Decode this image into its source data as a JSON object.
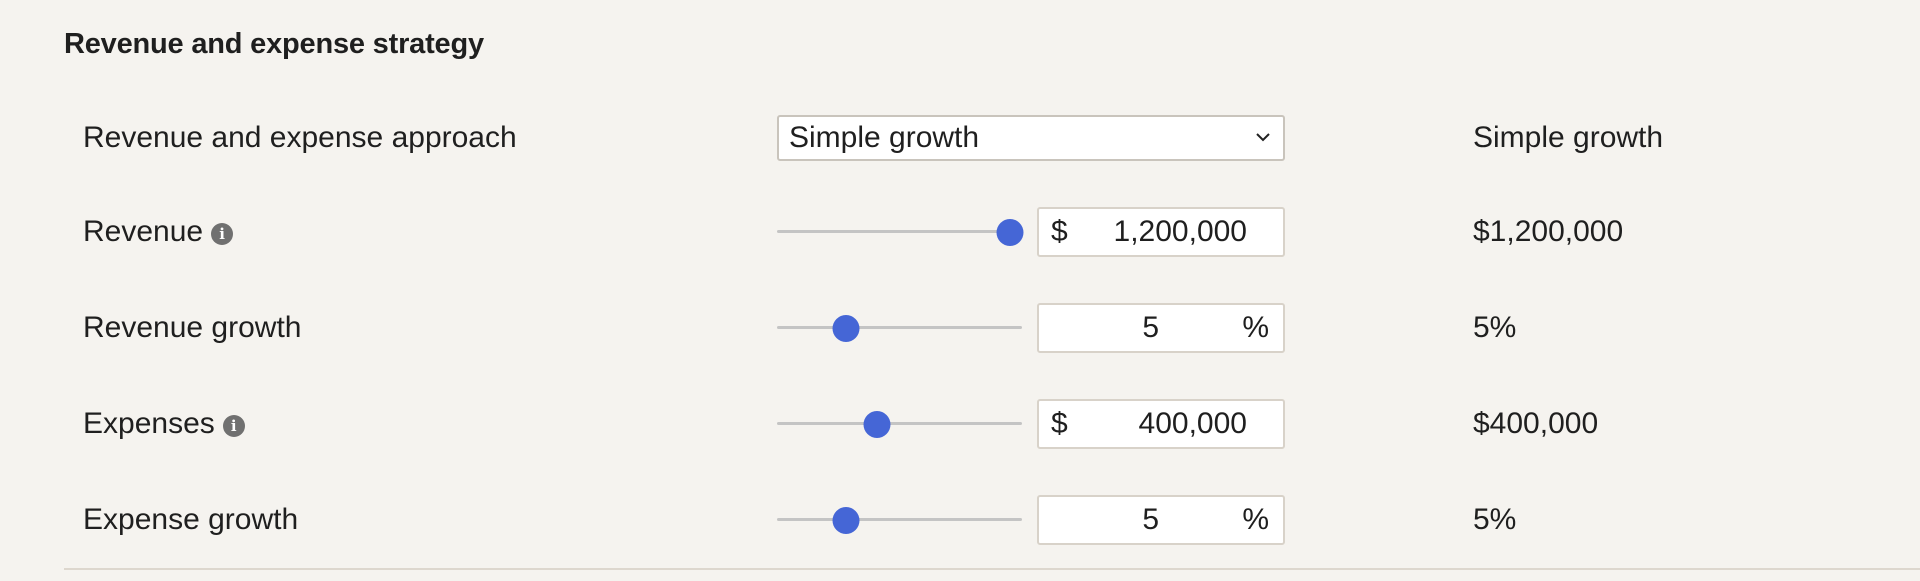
{
  "section": {
    "title": "Revenue and expense strategy"
  },
  "rows": {
    "approach": {
      "label": "Revenue and expense approach",
      "select_value": "Simple growth",
      "summary": "Simple growth"
    },
    "revenue": {
      "label": "Revenue",
      "prefix": "$",
      "value": "1,200,000",
      "summary": "$1,200,000",
      "slider_level": 0.95
    },
    "revenue_growth": {
      "label": "Revenue growth",
      "value": "5",
      "suffix": "%",
      "summary": "5%",
      "slider_level": 0.28
    },
    "expenses": {
      "label": "Expenses",
      "prefix": "$",
      "value": "400,000",
      "summary": "$400,000",
      "slider_level": 0.41
    },
    "expense_growth": {
      "label": "Expense growth",
      "value": "5",
      "suffix": "%",
      "summary": "5%",
      "slider_level": 0.28
    }
  },
  "colors": {
    "accent": "#4566d6",
    "background": "#f5f3ef"
  }
}
